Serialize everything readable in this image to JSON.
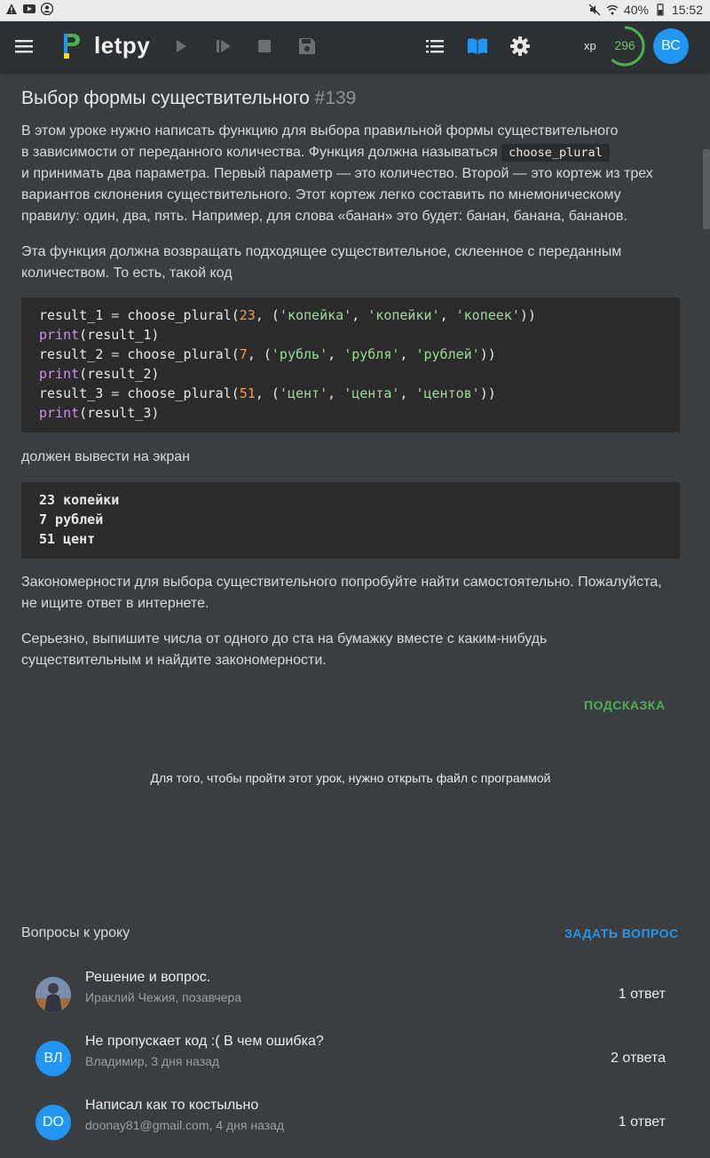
{
  "status_bar": {
    "battery": "40%",
    "time": "15:52"
  },
  "app_bar": {
    "logo_text": "letpy",
    "xp_label": "xp",
    "xp_value": "296",
    "xp_progress": 0.62,
    "user_initials": "ВС",
    "icons": [
      "menu-icon",
      "logo-icon",
      "run-icon",
      "step-icon",
      "stop-icon",
      "save-icon",
      "list-icon",
      "book-icon",
      "gear-icon"
    ],
    "accent_color": "#2196f3"
  },
  "lesson": {
    "title": "Выбор формы существительного",
    "number": "#139",
    "para1_l1": "В этом уроке нужно написать функцию для выбора правильной формы существительного",
    "para1_l2": "в зависимости от переданного количества. Функция должна называться",
    "para1_code": "choose_plural",
    "para1_l3": "и принимать два параметра. Первый параметр — это количество. Второй — это кортеж из трех",
    "para1_l4": "вариантов склонения существительного. Этот кортеж легко составить по мнемоническому",
    "para1_l5": "правилу: один, два, пять. Например, для слова «банан» это будет: банан, банана, бананов.",
    "para2_l1": "Эта функция должна возвращать подходящее существительное, склеенное с переданным",
    "para2_l2": "количеством. То есть, такой код",
    "code_lines": [
      "result_1 = choose_plural(23, ('копейка', 'копейки', 'копеек'))",
      "print(result_1)",
      "result_2 = choose_plural(7, ('рубль', 'рубля', 'рублей'))",
      "print(result_2)",
      "result_3 = choose_plural(51, ('цент', 'цента', 'центов'))",
      "print(result_3)"
    ],
    "para3": "должен вывести на экран",
    "output_lines": [
      "23 копейки",
      "7 рублей",
      "51 цент"
    ],
    "para4_l1": "Закономерности для выбора существительного попробуйте найти самостоятельно. Пожалуйста,",
    "para4_l2": "не ищите ответ в интернете.",
    "para5_l1": "Серьезно, выпишите числа от одного до ста на бумажку вместе с каким-нибудь",
    "para5_l2": "существительным и найдите закономерности.",
    "hint_button": "ПОДСКАЗКА",
    "open_file_note": "Для того, чтобы пройти этот урок, нужно открыть файл с программой"
  },
  "questions": {
    "heading": "Вопросы к уроку",
    "ask_button": "ЗАДАТЬ ВОПРОС",
    "items": [
      {
        "title": "Решение и вопрос.",
        "meta": "Ираклий Чежия, позавчера",
        "count": "1 ответ",
        "initials": "",
        "avatar_color": "#5a6e8a"
      },
      {
        "title": "Не пропускает код :( В чем ошибка?",
        "meta": "Владимир, 3 дня назад",
        "count": "2 ответа",
        "initials": "ВЛ",
        "avatar_color": "#2196f3"
      },
      {
        "title": "Написал как то костыльно",
        "meta": "doonay81@gmail.com, 4 дня назад",
        "count": "1 ответ",
        "initials": "DO",
        "avatar_color": "#2196f3"
      }
    ]
  }
}
